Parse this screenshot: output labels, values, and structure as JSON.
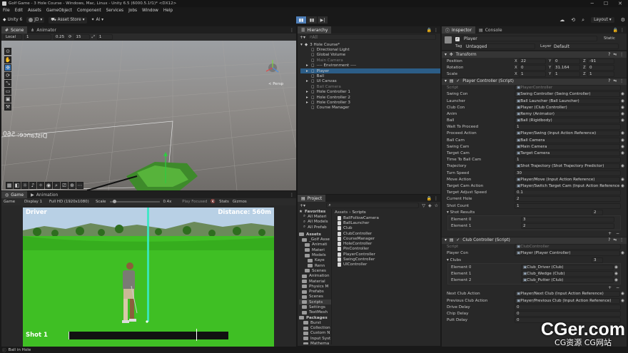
{
  "window": {
    "title": "Golf Game - 3 Hole Course - Windows, Mac, Linux - Unity 6.5 (6000.5.1f1)* <DX12>"
  },
  "menu": [
    "File",
    "Edit",
    "Assets",
    "GameObject",
    "Component",
    "Services",
    "Jobs",
    "Window",
    "Help"
  ],
  "toolbar": {
    "account": "Unity 6",
    "user": "JD",
    "asset_store": "Asset Store",
    "ai": "AI",
    "layout": "Layout"
  },
  "scene": {
    "tabs": [
      "Scene",
      "Animator"
    ],
    "toolbar_values": [
      "Local",
      "1",
      "0.25",
      "15",
      "1"
    ],
    "gizmo_label": "< Persp",
    "distance_text": "Distance: 560"
  },
  "game": {
    "tabs": [
      "Game",
      "Animation"
    ],
    "display_mode": "Game",
    "display": "Display 1",
    "resolution": "Full HD (1920x1080)",
    "scale_label": "Scale",
    "scale_value": "0.4x",
    "play_focused": "Play Focused",
    "stats": "Stats",
    "gizmos": "Gizmos",
    "hud_club": "Driver",
    "hud_distance": "Distance: 560m",
    "hud_shot": "Shot 1",
    "power": 0.8
  },
  "hierarchy": {
    "tab": "Hierarchy",
    "search_placeholder": "All",
    "root": "3 Hole Course*",
    "items": [
      "Directional Light",
      "Global Volume",
      "Main Camera",
      "---- Environment ----",
      "Player",
      "Ball",
      "UI Canvas",
      "Ball Camera",
      "Hole Controller 1",
      "Hole Controller 2",
      "Hole Controller 3",
      "Course Manager"
    ]
  },
  "project": {
    "tab": "Project",
    "breadcrumb": [
      "Assets",
      "Scripts"
    ],
    "favorites_label": "Favorites",
    "favorites": [
      "All Materi",
      "All Models",
      "All Prefab"
    ],
    "assets_label": "Assets",
    "tree": [
      "_Golf Asse",
      "Animati",
      "Materi",
      "Models",
      "Kaye",
      "Renn",
      "Scenes",
      "Animation",
      "Material",
      "Physics M",
      "Prefabs",
      "Scenes",
      "Scripts",
      "Settings",
      "TextMesh"
    ],
    "packages_label": "Packages",
    "packages": [
      "Burst",
      "Collection",
      "Custom N",
      "Input Syst",
      "Mathema"
    ],
    "files": [
      "BallFollowCamera",
      "BallLauncher",
      "Club",
      "ClubController",
      "CourseManager",
      "HoleController",
      "PinController",
      "PlayerController",
      "SwingController",
      "UIController"
    ]
  },
  "inspector": {
    "tabs": [
      "Inspector",
      "Console"
    ],
    "object_name": "Player",
    "static_label": "Static",
    "tag_label": "Tag",
    "tag": "Untagged",
    "layer_label": "Layer",
    "layer": "Default",
    "transform": {
      "title": "Transform",
      "rows": [
        {
          "label": "Position",
          "x": "22",
          "y": "0",
          "z": "-91"
        },
        {
          "label": "Rotation",
          "x": "0",
          "y": "31.164",
          "z": "0"
        },
        {
          "label": "Scale",
          "x": "1",
          "y": "1",
          "z": "1"
        }
      ]
    },
    "player_controller": {
      "title": "Player Controller (Script)",
      "rows": [
        {
          "label": "Script",
          "value": "PlayerController"
        },
        {
          "label": "Swing Con",
          "value": "Swing Controller (Swing Controller)"
        },
        {
          "label": "Launcher",
          "value": "Ball Launcher (Ball Launcher)"
        },
        {
          "label": "Club Con",
          "value": "Player (Club Controller)"
        },
        {
          "label": "Anim",
          "value": "Remy (Animator)"
        },
        {
          "label": "Ball",
          "value": "Ball (Rigidbody)"
        },
        {
          "label": "Wait To Proceed",
          "value": "1"
        },
        {
          "label": "Proceed Action",
          "value": "Player/Swing (Input Action Reference)"
        },
        {
          "label": "Ball Cam",
          "value": "Ball Camera"
        },
        {
          "label": "Swing Cam",
          "value": "Main Camera"
        },
        {
          "label": "Target Cam",
          "value": "Target Camera"
        },
        {
          "label": "Time To Ball Cam",
          "value": "1"
        },
        {
          "label": "Trajectory",
          "value": "Shot Trajectory (Shot Trajectory Predictor)"
        },
        {
          "label": "Turn Speed",
          "value": "30"
        },
        {
          "label": "Move Action",
          "value": "Player/Move (Input Action Reference)"
        },
        {
          "label": "Target Cam Action",
          "value": "Player/Switch Target Cam (Input Action Reference)"
        },
        {
          "label": "Target Adjust Speed",
          "value": "0.1"
        },
        {
          "label": "Current Hole",
          "value": "2"
        },
        {
          "label": "Shot Count",
          "value": "1"
        }
      ],
      "shot_results_label": "Shot Results",
      "shot_results_count": "2",
      "shot_results": [
        {
          "label": "Element 0",
          "value": "3"
        },
        {
          "label": "Element 1",
          "value": "2"
        }
      ]
    },
    "club_controller": {
      "title": "Club Controller (Script)",
      "rows": [
        {
          "label": "Script",
          "value": "ClubController"
        },
        {
          "label": "Player Con",
          "value": "Player (Player Controller)"
        }
      ],
      "clubs_label": "Clubs",
      "clubs_count": "3",
      "clubs": [
        {
          "label": "Element 0",
          "value": "Club_Driver (Club)"
        },
        {
          "label": "Element 1",
          "value": "Club_Wedge (Club)"
        },
        {
          "label": "Element 2",
          "value": "Club_Putter (Club)"
        }
      ],
      "rows2": [
        {
          "label": "Next Club Action",
          "value": "Player/Next Club (Input Action Reference)"
        },
        {
          "label": "Previous Club Action",
          "value": "Player/Previous Club (Input Action Reference)"
        },
        {
          "label": "Drive Delay",
          "value": "0"
        },
        {
          "label": "Chip Delay",
          "value": "0"
        },
        {
          "label": "Putt Delay",
          "value": "0"
        }
      ]
    }
  },
  "status_bar": {
    "text": "Ball in Hole"
  },
  "watermark": {
    "main": "CGer.com",
    "sub": "CG资源 CG网站"
  },
  "colors": {
    "accent": "#3a79bb",
    "grass": "#3fbf24",
    "sky": "#a8c4dc",
    "panel": "#282828"
  }
}
